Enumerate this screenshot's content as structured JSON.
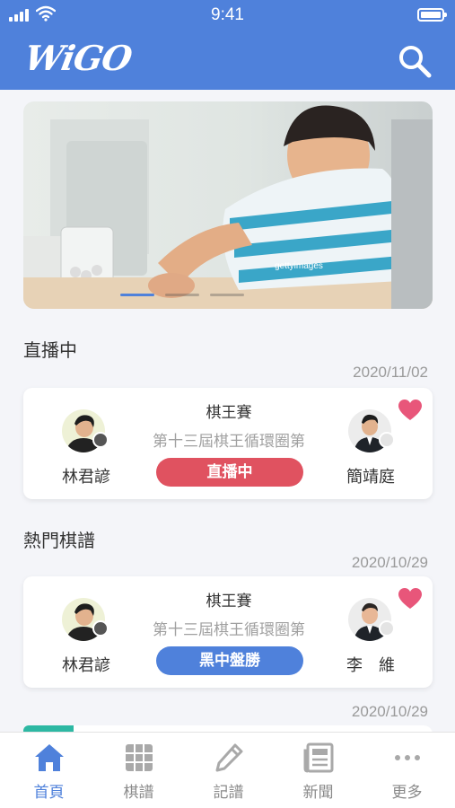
{
  "status_bar": {
    "time": "9:41"
  },
  "header": {
    "logo_text": "WiGO",
    "search_icon": "search-icon"
  },
  "banner": {
    "watermark": "gettyimages",
    "slides": 3,
    "active_slide": 1
  },
  "sections": [
    {
      "title": "直播中",
      "date": "2020/11/02",
      "card": {
        "title": "棋王賽",
        "subtitle": "第十三屆棋王循環圈第",
        "player_left": "林君諺",
        "player_right": "簡靖庭",
        "status": "直播中",
        "status_color": "#e05260",
        "favorited": true
      }
    },
    {
      "title": "熱門棋譜",
      "date": "2020/10/29",
      "card": {
        "title": "棋王賽",
        "subtitle": "第十三屆棋王循環圈第",
        "player_left": "林君諺",
        "player_right": "李　維",
        "status": "黑中盤勝",
        "status_color": "#4f81db",
        "favorited": true
      }
    }
  ],
  "next_date": "2020/10/29",
  "tabbar": {
    "items": [
      {
        "label": "首頁",
        "icon": "home-icon",
        "active": true
      },
      {
        "label": "棋譜",
        "icon": "board-icon",
        "active": false
      },
      {
        "label": "記譜",
        "icon": "pencil-icon",
        "active": false
      },
      {
        "label": "新聞",
        "icon": "news-icon",
        "active": false
      },
      {
        "label": "更多",
        "icon": "more-icon",
        "active": false
      }
    ]
  },
  "colors": {
    "primary": "#4f81db",
    "live": "#e05260",
    "heart": "#e8567a",
    "tag": "#2db8a3"
  }
}
